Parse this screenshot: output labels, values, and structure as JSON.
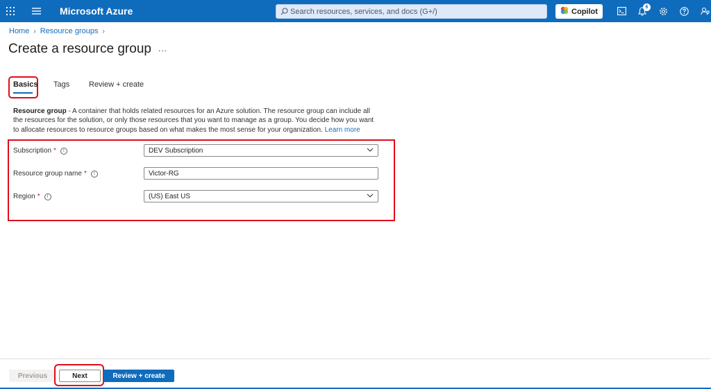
{
  "topbar": {
    "brand": "Microsoft Azure",
    "search_placeholder": "Search resources, services, and docs (G+/)",
    "copilot_label": "Copilot",
    "notification_count": "6",
    "bar_color": "#0f6cbd"
  },
  "breadcrumb": {
    "items": [
      "Home",
      "Resource groups"
    ]
  },
  "page": {
    "title": "Create a resource group",
    "more_label": "..."
  },
  "tabs": [
    {
      "label": "Basics",
      "active": true
    },
    {
      "label": "Tags",
      "active": false
    },
    {
      "label": "Review + create",
      "active": false
    }
  ],
  "description": {
    "bold": "Resource group",
    "text": " - A container that holds related resources for an Azure solution. The resource group can include all the resources for the solution, or only those resources that you want to manage as a group. You decide how you want to allocate resources to resource groups based on what makes the most sense for your organization.",
    "link": "Learn more"
  },
  "form": {
    "subscription": {
      "label": "Subscription",
      "required": "*",
      "value": "DEV Subscription"
    },
    "resource_group_name": {
      "label": "Resource group name",
      "required": "*",
      "value": "Victor-RG"
    },
    "region": {
      "label": "Region",
      "required": "*",
      "value": "(US) East US"
    }
  },
  "footer": {
    "previous_label": "Previous",
    "next_label": "Next",
    "review_create_label": "Review + create"
  },
  "icons": {
    "waffle": "app-launcher-icon",
    "menu": "hamburger-menu-icon",
    "search": "search-icon",
    "copilot": "copilot-icon",
    "cloud_shell": "cloud-shell-icon",
    "notifications": "bell-icon",
    "settings": "gear-icon",
    "help": "help-icon",
    "feedback": "feedback-icon",
    "info": "info-icon",
    "dropdown": "chevron-down-icon"
  },
  "highlight_color": "#e00b1c"
}
